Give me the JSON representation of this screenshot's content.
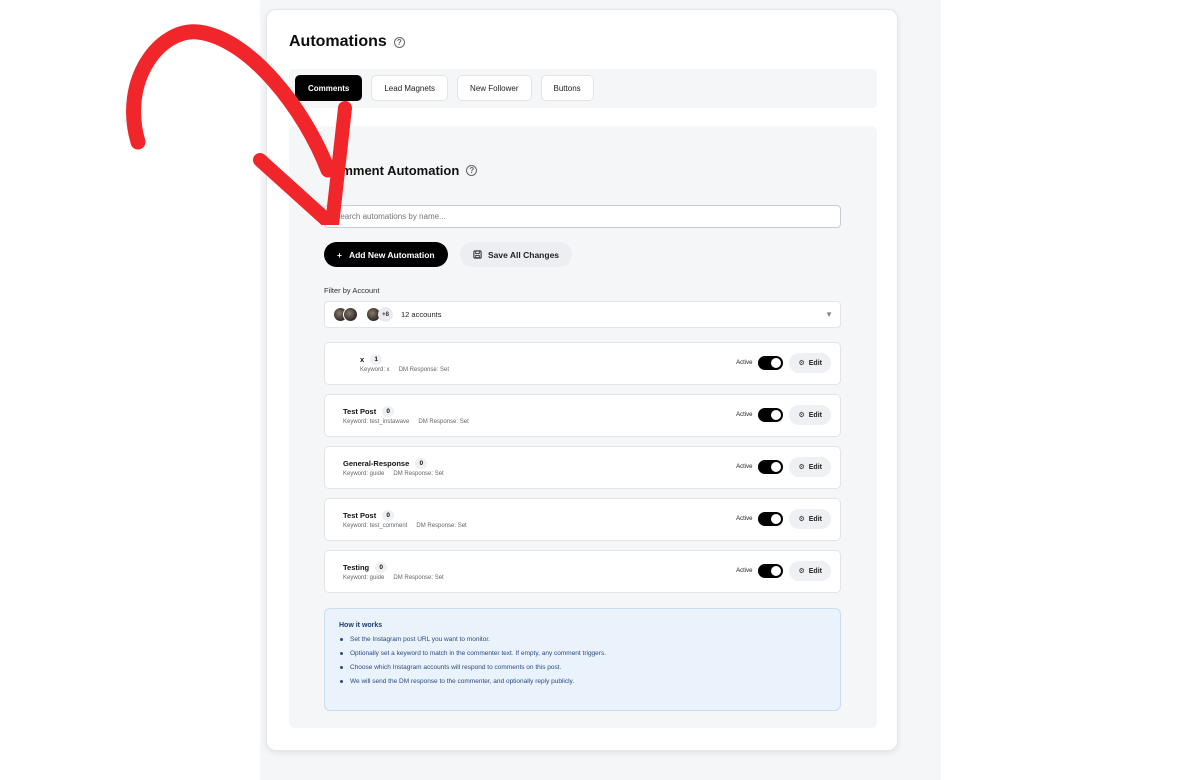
{
  "page": {
    "title": "Automations"
  },
  "tabs": [
    {
      "label": "Comments",
      "active": true
    },
    {
      "label": "Lead Magnets",
      "active": false
    },
    {
      "label": "New Follower",
      "active": false
    },
    {
      "label": "Buttons",
      "active": false
    }
  ],
  "section": {
    "title": "Comment Automation",
    "search_placeholder": "Search automations by name...",
    "add_button": "Add New Automation",
    "save_button": "Save All Changes"
  },
  "filter": {
    "label": "Filter by Account",
    "more_count": "+8",
    "accounts_text": "12 accounts"
  },
  "automations": [
    {
      "name": "x",
      "count": "1",
      "keyword": "Keyword: x",
      "dm": "DM Response: Set",
      "status": "Active",
      "edit": "Edit"
    },
    {
      "name": "Test Post",
      "count": "0",
      "keyword": "Keyword: test_instawave",
      "dm": "DM Response: Set",
      "status": "Active",
      "edit": "Edit"
    },
    {
      "name": "General-Response",
      "count": "0",
      "keyword": "Keyword: guide",
      "dm": "DM Response: Set",
      "status": "Active",
      "edit": "Edit"
    },
    {
      "name": "Test Post",
      "count": "0",
      "keyword": "Keyword: test_comment",
      "dm": "DM Response: Set",
      "status": "Active",
      "edit": "Edit"
    },
    {
      "name": "Testing",
      "count": "0",
      "keyword": "Keyword: guide",
      "dm": "DM Response: Set",
      "status": "Active",
      "edit": "Edit"
    }
  ],
  "how_it_works": {
    "title": "How it works",
    "items": [
      "Set the Instagram post URL you want to monitor.",
      "Optionally set a keyword to match in the commenter text. If empty, any comment triggers.",
      "Choose which Instagram accounts will respond to comments on this post.",
      "We will send the DM response to the commenter, and optionally reply publicly."
    ]
  },
  "colors": {
    "accent": "#000000",
    "annotation_arrow": "#f0262b",
    "info_bg": "#eaf2fb"
  },
  "icons": {
    "help": "help-circle-icon",
    "plus": "plus-icon",
    "save": "save-icon",
    "edit": "gear-icon",
    "caret": "chevron-down-icon"
  }
}
